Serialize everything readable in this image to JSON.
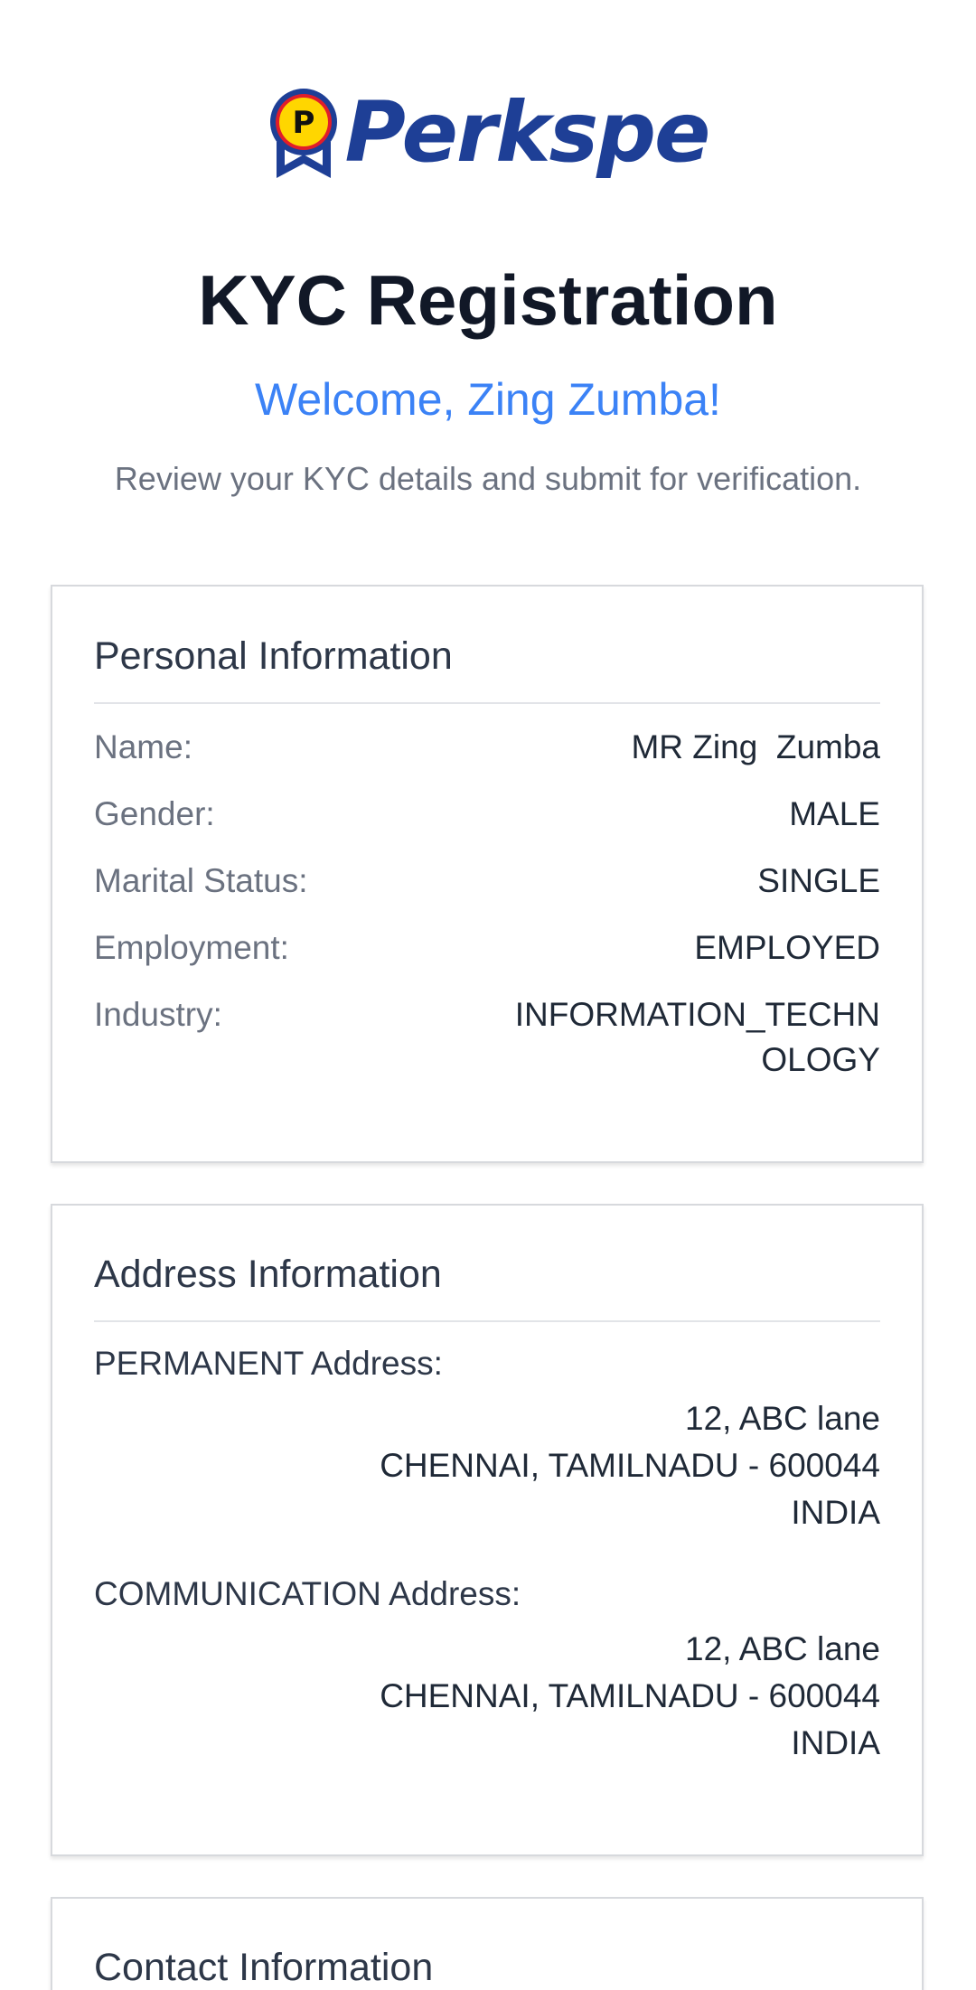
{
  "brand": {
    "logo_text": "Perkspe",
    "badge_letter": "P"
  },
  "header": {
    "title": "KYC Registration",
    "welcome": "Welcome, Zing Zumba!",
    "subtitle": "Review your KYC details and submit for verification."
  },
  "personal": {
    "title": "Personal Information",
    "rows": [
      {
        "label": "Name:",
        "value": "MR Zing  Zumba"
      },
      {
        "label": "Gender:",
        "value": "MALE"
      },
      {
        "label": "Marital Status:",
        "value": "SINGLE"
      },
      {
        "label": "Employment:",
        "value": "EMPLOYED"
      },
      {
        "label": "Industry:",
        "value": "INFORMATION_TECHNOLOGY"
      }
    ]
  },
  "address": {
    "title": "Address Information",
    "permanent": {
      "label": "PERMANENT Address:",
      "line1": "12, ABC lane",
      "line2": "CHENNAI, TAMILNADU - 600044",
      "line3": "INDIA"
    },
    "communication": {
      "label": "COMMUNICATION Address:",
      "line1": "12, ABC lane",
      "line2": "CHENNAI, TAMILNADU - 600044",
      "line3": "INDIA"
    }
  },
  "contact": {
    "title": "Contact Information"
  },
  "colors": {
    "brand_navy": "#1e3f96",
    "accent_blue": "#3b82f6",
    "badge_yellow": "#ffd600",
    "badge_red": "#e11d2a"
  }
}
